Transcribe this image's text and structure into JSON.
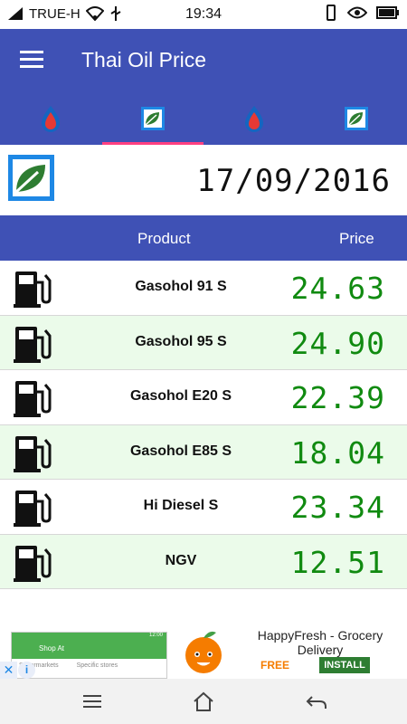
{
  "status": {
    "carrier": "TRUE-H",
    "time": "19:34"
  },
  "app": {
    "title": "Thai Oil Price"
  },
  "tabs": [
    {
      "icon": "ptt-drop-icon",
      "selected": false
    },
    {
      "icon": "bangchak-leaf-icon",
      "selected": true
    },
    {
      "icon": "ptt-drop-icon",
      "selected": false
    },
    {
      "icon": "bangchak-leaf-icon",
      "selected": false
    }
  ],
  "date": "17/09/2016",
  "table": {
    "headers": {
      "product": "Product",
      "price": "Price"
    },
    "rows": [
      {
        "name": "Gasohol 91 S",
        "price": "24.63"
      },
      {
        "name": "Gasohol 95 S",
        "price": "24.90"
      },
      {
        "name": "Gasohol E20 S",
        "price": "22.39"
      },
      {
        "name": "Gasohol E85 S",
        "price": "18.04"
      },
      {
        "name": "Hi Diesel S",
        "price": "23.34"
      },
      {
        "name": "NGV",
        "price": "12.51"
      }
    ]
  },
  "ad": {
    "preview_heading": "Shop At",
    "preview_col1": "Supermarkets",
    "preview_col2": "Specific stores",
    "title": "HappyFresh - Grocery Delivery",
    "price": "FREE",
    "cta": "INSTALL",
    "close": "✕",
    "info": "i",
    "preview_time": "12:00"
  },
  "colors": {
    "primary": "#3f51b5",
    "accent": "#ff4081",
    "price_green": "#108a10",
    "alt_row": "#ebfbea"
  }
}
